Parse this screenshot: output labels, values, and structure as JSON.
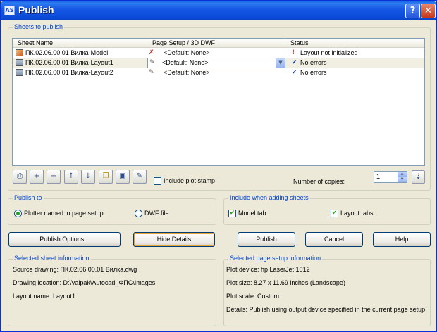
{
  "window": {
    "title": "Publish",
    "app_icon_text": "AS",
    "help_glyph": "?",
    "close_glyph": "✕"
  },
  "sheets": {
    "group_title": "Sheets to publish",
    "columns": [
      "Sheet Name",
      "Page Setup / 3D DWF",
      "Status"
    ],
    "rows": [
      {
        "name": "ПК.02.06.00.01 Вилка-Model",
        "page_setup": "<Default: None>",
        "status": "Layout not initialized",
        "status_icon": "warning-icon"
      },
      {
        "name": "ПК.02.06.00.01 Вилка-Layout1",
        "page_setup": "<Default: None>",
        "status": "No errors",
        "status_icon": "check-icon"
      },
      {
        "name": "ПК.02.06.00.01 Вилка-Layout2",
        "page_setup": "<Default: None>",
        "status": "No errors",
        "status_icon": "check-icon"
      }
    ]
  },
  "toolbar": {
    "icons": [
      "preview-icon",
      "add-sheets-icon",
      "remove-sheets-icon",
      "move-up-icon",
      "move-down-icon",
      "load-list-icon",
      "save-list-icon",
      "plot-stamp-settings-icon"
    ],
    "include_plot_stamp_label": "Include plot stamp",
    "include_plot_stamp_checked": false,
    "copies_label": "Number of copies:",
    "copies_value": "1"
  },
  "publish_to": {
    "group_title": "Publish to",
    "options": [
      "Plotter named in page setup",
      "DWF file"
    ],
    "selected": "Plotter named in page setup"
  },
  "include": {
    "group_title": "Include when adding sheets",
    "model_tab_label": "Model tab",
    "model_tab_checked": true,
    "layout_tabs_label": "Layout tabs",
    "layout_tabs_checked": true
  },
  "buttons": {
    "publish_options": "Publish Options...",
    "hide_details": "Hide Details",
    "publish": "Publish",
    "cancel": "Cancel",
    "help": "Help"
  },
  "sheet_info": {
    "group_title": "Selected sheet information",
    "source": "Source drawing: ПК.02.06.00.01 Вилка.dwg",
    "location": "Drawing location: D:\\Valpak\\Autocad_ФПС\\Images",
    "layout": "Layout name: Layout1"
  },
  "page_info": {
    "group_title": "Selected page setup information",
    "device": "Plot device: hp LaserJet 1012",
    "size": "Plot size: 8.27 x 11.69 inches (Landscape)",
    "scale": "Plot scale: Custom",
    "details": "Details: Publish using output device specified in the current page setup"
  },
  "colors": {
    "title_bar": "#0A4CD8",
    "dialog_bg": "#ECE9D8",
    "group_title": "#0046D5",
    "checkmark": "#21A121"
  }
}
